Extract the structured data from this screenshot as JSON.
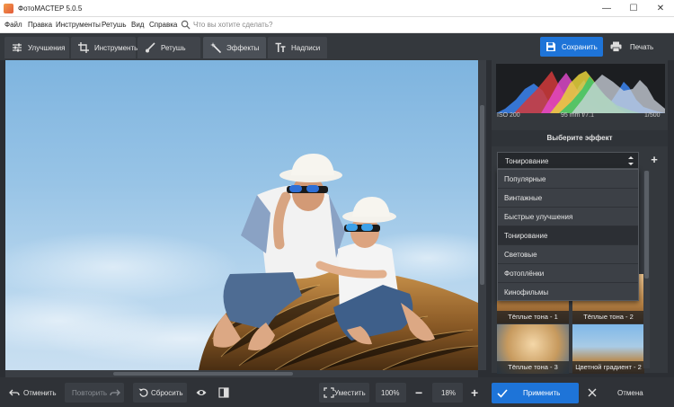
{
  "window": {
    "title": "ФотоМАСТЕР 5.0.5",
    "minimize": "—",
    "maximize": "☐",
    "close": "✕"
  },
  "menu": {
    "items": [
      "Файл",
      "Правка",
      "Инструменты",
      "Ретушь",
      "Вид",
      "Справка"
    ],
    "search_placeholder": "Что вы хотите сделать?"
  },
  "tabs": [
    {
      "label": "Улучшения",
      "icon": "sliders-icon"
    },
    {
      "label": "Инструменты",
      "icon": "crop-icon"
    },
    {
      "label": "Ретушь",
      "icon": "brush-icon"
    },
    {
      "label": "Эффекты",
      "icon": "magic-wand-icon",
      "active": true
    },
    {
      "label": "Надписи",
      "icon": "text-icon"
    }
  ],
  "toolbar": {
    "save_label": "Сохранить",
    "print_label": "Печать"
  },
  "histogram": {
    "iso": "ISO 200",
    "lens": "95 mm f/7.1",
    "shutter": "1/500"
  },
  "effects_panel": {
    "title": "Выберите эффект",
    "selected": "Тонирование",
    "add": "+",
    "options": [
      "Популярные",
      "Винтажные",
      "Быстрые улучшения",
      "Тонирование",
      "Световые",
      "Фотоплёнки",
      "Кинофильмы"
    ],
    "thumbnails": [
      "Тёплые тона - 1",
      "Тёплые тона - 2",
      "Тёплые тона - 3",
      "Цветной градиент - 2"
    ]
  },
  "bottom": {
    "undo_label": "Отменить",
    "redo_label": "Повторить",
    "reset_label": "Сбросить",
    "fit_label": "Уместить",
    "zoom_full": "100%",
    "zoom_value": "18%",
    "zoom_minus": "−",
    "zoom_plus": "+",
    "apply_label": "Применить",
    "cancel_label": "Отмена"
  },
  "colors": {
    "accent": "#1e74d8",
    "panel": "#34383d",
    "background": "#2b2e33"
  }
}
